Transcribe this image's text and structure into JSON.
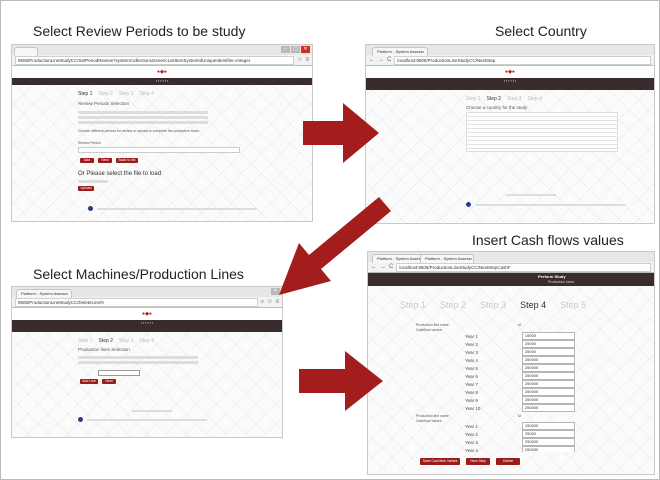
{
  "captions": {
    "review": "Select Review Periods to be study",
    "country": "Select Country",
    "cash": "Insert Cash flows values",
    "machines": "Select Machines/Production Lines"
  },
  "screen1": {
    "url": "9506/ProductionLineStudyCC/SetPeriodReview?systemCollectionsGenericListItemSystemIdUniqueIdentifier=Integer",
    "steps": [
      "Step 1",
      "Step 2",
      "Step 3",
      "Step 4"
    ],
    "heading": "Review Periods Selection",
    "note": "Choose different periods for review or upload to complete the production flows",
    "field_label": "Review Period",
    "buttons": [
      "Add",
      "Next",
      "Back to list"
    ],
    "upload_title": "Or Please select the file to load",
    "upload_button": "Upload"
  },
  "screen2": {
    "tab": "Platform - System Assessr",
    "url": "localhost:9506/ProductionLineStudyCC/NextStep",
    "steps": [
      "Step 1",
      "Step 2",
      "Step 3",
      "Step 4"
    ],
    "heading": "Choose a country for the study"
  },
  "screen3": {
    "tab": "Platform - System Assessr",
    "url": "9506/ProductionLineStudyCC/DeleteLine/0",
    "steps": [
      "Step 1",
      "Step 2",
      "Step 3",
      "Step 4"
    ],
    "heading": "Production lines Selection",
    "buttons": [
      "Add Line",
      "Next"
    ]
  },
  "screen4": {
    "tabs": [
      "Platform - System Assessr",
      "Platform - System Assessr"
    ],
    "url": "localhost:9506/ProductionLineStudyCC/NextStepCashF",
    "header_title": "Perform Study",
    "header_sub": "Production Lines",
    "steps": [
      "Step 1",
      "Step 2",
      "Step 3",
      "Step 4",
      "Step 5"
    ],
    "active_step": "Step 4",
    "block1": {
      "label": "Production line name",
      "sub": "Cashflow values",
      "code": "M",
      "rows": [
        {
          "year": "Year 1",
          "value": "15000"
        },
        {
          "year": "Year 2",
          "value": "25000"
        },
        {
          "year": "Year 3",
          "value": "25000"
        },
        {
          "year": "Year 4",
          "value": "250000"
        },
        {
          "year": "Year 5",
          "value": "250000"
        },
        {
          "year": "Year 6",
          "value": "250000"
        },
        {
          "year": "Year 7",
          "value": "250000"
        },
        {
          "year": "Year 8",
          "value": "250000"
        },
        {
          "year": "Year 9",
          "value": "250000"
        },
        {
          "year": "Year 10",
          "value": "250000"
        }
      ]
    },
    "block2": {
      "label": "Production line name",
      "sub": "Cashflow values",
      "code": "M",
      "rows": [
        {
          "year": "Year 1",
          "value": "150000"
        },
        {
          "year": "Year 2",
          "value": "25000"
        },
        {
          "year": "Year 3",
          "value": "250000"
        },
        {
          "year": "Year 4",
          "value": "250000"
        },
        {
          "year": "Year 5",
          "value": "250000"
        },
        {
          "year": "Year 6",
          "value": "250000"
        },
        {
          "year": "Year 7",
          "value": "250000"
        },
        {
          "year": "Year 8",
          "value": "250000"
        },
        {
          "year": "Year 9",
          "value": "250000"
        },
        {
          "year": "Year 10",
          "value": "250000"
        }
      ]
    },
    "buttons": [
      "Save Cashflow Values",
      "Next Step",
      "Delete"
    ]
  },
  "colors": {
    "arrow": "#a31d1d",
    "accent": "#9b1b1b",
    "navbar": "#3a2c2c"
  }
}
